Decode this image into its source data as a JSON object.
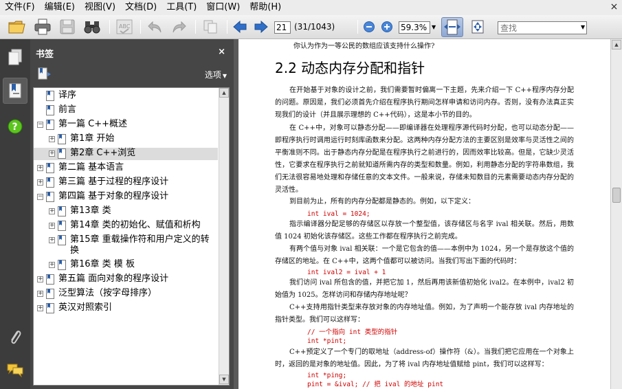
{
  "menu": {
    "items": [
      "文件(F)",
      "编辑(E)",
      "视图(V)",
      "文档(D)",
      "工具(T)",
      "窗口(W)",
      "帮助(H)"
    ],
    "close_glyph": "×"
  },
  "toolbar": {
    "page_current": "21",
    "page_count": "(31/1043)",
    "zoom": "59.3%",
    "search_placeholder": "查找",
    "icons": [
      "open-folder-icon",
      "print-icon",
      "save-icon",
      "find-binoculars-icon",
      "spellcheck-icon",
      "undo-icon",
      "redo-icon",
      "copy-icon",
      "prev-page-icon",
      "next-page-icon",
      "zoom-out-icon",
      "zoom-in-icon",
      "fit-width-icon",
      "fit-page-icon"
    ]
  },
  "rail": {
    "icons": [
      "pages-icon",
      "bookmarks-icon",
      "help-icon",
      "attachment-icon",
      "comments-icon"
    ]
  },
  "bookmarks": {
    "title": "书签",
    "close_glyph": "×",
    "options_label": "选项",
    "items": [
      {
        "label": "译序",
        "level": 0,
        "expander": ""
      },
      {
        "label": "前言",
        "level": 0,
        "expander": ""
      },
      {
        "label": "第一篇 C++概述",
        "level": 0,
        "expander": "−"
      },
      {
        "label": "第1章 开始",
        "level": 1,
        "expander": "+"
      },
      {
        "label": "第2章 C++浏览",
        "level": 1,
        "expander": "+",
        "selected": true
      },
      {
        "label": "第二篇 基本语言",
        "level": 0,
        "expander": "+"
      },
      {
        "label": "第三篇 基于过程的程序设计",
        "level": 0,
        "expander": "+"
      },
      {
        "label": "第四篇 基于对象的程序设计",
        "level": 0,
        "expander": "−"
      },
      {
        "label": "第13章 类",
        "level": 1,
        "expander": "+"
      },
      {
        "label": "第14章 类的初始化、赋值和析构",
        "level": 1,
        "expander": "+"
      },
      {
        "label": "第15章 重载操作符和用户定义的转换",
        "level": 1,
        "expander": "+"
      },
      {
        "label": "第16章 类 模 板",
        "level": 1,
        "expander": "+"
      },
      {
        "label": "第五篇 面向对象的程序设计",
        "level": 0,
        "expander": "+"
      },
      {
        "label": "泛型算法（按字母排序）",
        "level": 0,
        "expander": "+"
      },
      {
        "label": "英汉对照索引",
        "level": 0,
        "expander": "+"
      }
    ]
  },
  "document": {
    "top_line": "你认为作为一等公民的数组应该支持什么操作?",
    "heading": "2.2  动态内存分配和指针",
    "paragraphs": [
      "在开始基于对象的设计之前，我们需要暂时偏离一下主题，先来介绍一下 C++程序内存分配的问题。原因是，我们必须首先介绍在程序执行期间怎样申请和访问内存。否则，没有办法真正实现我们的设计（并且展示理想的 C++代码），这是本小节的目的。",
      "在 C++中，对象可以静态分配——即编译器在处理程序源代码时分配，也可以动态分配——即程序执行时调用运行时刻库函数来分配。这两种内存分配方法的主要区别是效率与灵活性之间的平衡准则不同。出于静态内存分配是在程序执行之前进行的，因而效率比较高。但是，它缺少灵活性，它要求在程序执行之前就知道所需内存的类型和数量。例如，利用静态分配的字符串数组，我们无法很容易地处理和存储任意的文本文件。一般来说，存储未知数目的元素需要动态内存分配的灵活性。",
      "到目前为止，所有的内存分配都是静态的。例如，以下定义：",
      "指示编译器分配足够的存储区以存放一个整型值，该存储区与名字 ival 相关联。然后，用数值 1024 初始化该存储区。这些工作都在程序执行之前完成。",
      "有两个值与对象 ival 相关联：一个是它包含的值——本例中为 1024，另一个是存放这个值的存储区的地址。在 C++中，这两个值都可以被访问。当我们写出下面的代码时：",
      "我们访问 ival 所包含的值，并把它加 1，然后再用该新值初始化 ival2。在本例中，ival2 初始值为 1025。怎样访问和存储内存地址呢？",
      "C++支持用指针类型来存放对象的内存地址值。例如，为了声明一个能存放 ival 内存地址的指针类型。我们可以这样写：",
      "C++预定义了一个专门的取地址（address-of）操作符（&）。当我们把它应用在一个对象上时，返回的是对象的地址值。因此，为了将 ival 内存地址值赋给 pint，我们可以这样写："
    ],
    "code": {
      "c1": "int ival = 1024;",
      "c2": "int ival2 = ival + 1",
      "c3": "// 一个指向 int 类型的指针",
      "c4": "int *pint;",
      "c5": "int *ping;",
      "c6": "pint = &ival; // 把 ival 的地址 pint"
    }
  }
}
